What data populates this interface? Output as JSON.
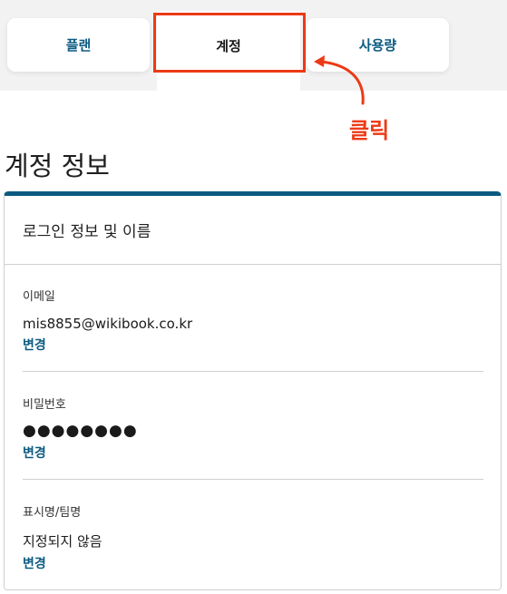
{
  "tabs": {
    "plan_label": "플랜",
    "account_label": "계정",
    "usage_label": "사용량"
  },
  "annotation": {
    "click_label": "클릭",
    "color": "#ec3a16"
  },
  "page": {
    "title": "계정 정보"
  },
  "card": {
    "title": "로그인 정보 및 이름",
    "accent_color": "#0b5a80",
    "sections": [
      {
        "label": "이메일",
        "value": "mis8855@wikibook.co.kr",
        "action": "변경"
      },
      {
        "label": "비밀번호",
        "value": "●●●●●●●●",
        "action": "변경"
      },
      {
        "label": "표시명/팀명",
        "value": "지정되지 않음",
        "action": "변경"
      }
    ]
  },
  "icons": [
    "curved-arrow-icon"
  ]
}
